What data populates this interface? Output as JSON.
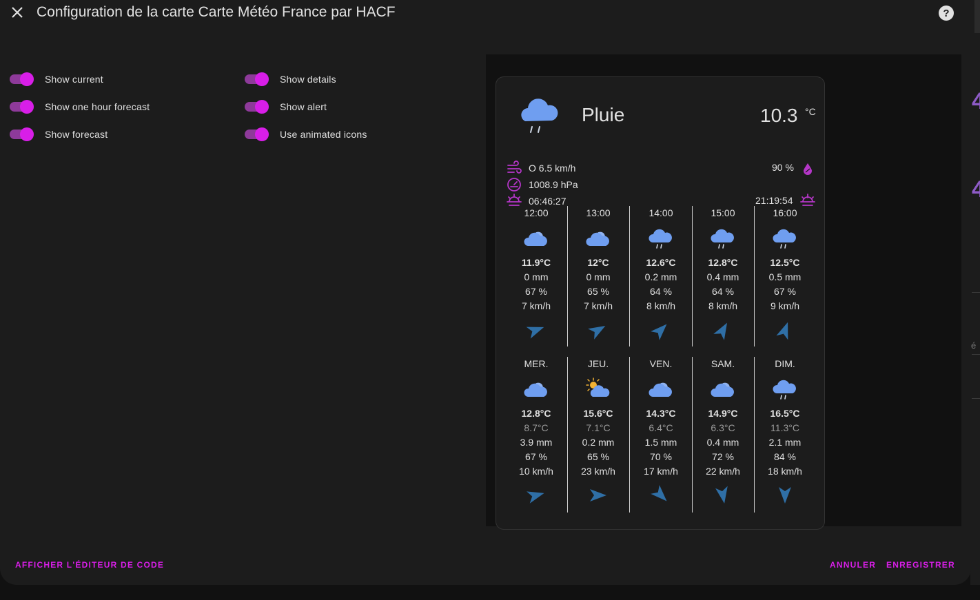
{
  "dialog": {
    "title": "Configuration de la carte Carte Météo France par HACF",
    "help_label": "?",
    "code_editor_label": "AFFICHER L'ÉDITEUR DE CODE",
    "cancel_label": "ANNULER",
    "save_label": "ENREGISTRER"
  },
  "toggles": [
    {
      "label": "Show current",
      "checked": true
    },
    {
      "label": "Show one hour forecast",
      "checked": true
    },
    {
      "label": "Show forecast",
      "checked": true
    },
    {
      "label": "Show details",
      "checked": true
    },
    {
      "label": "Show alert",
      "checked": true
    },
    {
      "label": "Use animated icons",
      "checked": true
    }
  ],
  "colors": {
    "accent": "#d81ee8",
    "icon_cloud": "#6f9ef0",
    "wind_arrow": "#2f6fa6"
  },
  "current": {
    "condition": "Pluie",
    "icon": "rainy-icon",
    "temperature": "10.3",
    "unit": "°C",
    "wind": "O 6.5 km/h",
    "humidity": "90 %",
    "pressure": "1008.9 hPa",
    "sunrise": "06:46:27",
    "sunset": "21:19:54"
  },
  "hourly": [
    {
      "time": "12:00",
      "icon": "cloudy-icon",
      "temp": "11.9°C",
      "precip": "0 mm",
      "humidity": "67 %",
      "wind": "7 km/h",
      "wind_deg": 70
    },
    {
      "time": "13:00",
      "icon": "cloudy-icon",
      "temp": "12°C",
      "precip": "0 mm",
      "humidity": "65 %",
      "wind": "7 km/h",
      "wind_deg": 60
    },
    {
      "time": "14:00",
      "icon": "rainy-icon",
      "temp": "12.6°C",
      "precip": "0.2 mm",
      "humidity": "64 %",
      "wind": "8 km/h",
      "wind_deg": 45
    },
    {
      "time": "15:00",
      "icon": "rainy-icon",
      "temp": "12.8°C",
      "precip": "0.4 mm",
      "humidity": "64 %",
      "wind": "8 km/h",
      "wind_deg": 30
    },
    {
      "time": "16:00",
      "icon": "rainy-icon",
      "temp": "12.5°C",
      "precip": "0.5 mm",
      "humidity": "67 %",
      "wind": "9 km/h",
      "wind_deg": 20
    }
  ],
  "daily": [
    {
      "day": "MER.",
      "icon": "cloudy-icon",
      "temp_high": "12.8°C",
      "temp_low": "8.7°C",
      "precip": "3.9 mm",
      "humidity": "67 %",
      "wind": "10 km/h",
      "wind_deg": 75
    },
    {
      "day": "JEU.",
      "icon": "partly-cloudy-icon",
      "temp_high": "15.6°C",
      "temp_low": "7.1°C",
      "precip": "0.2 mm",
      "humidity": "65 %",
      "wind": "23 km/h",
      "wind_deg": 90
    },
    {
      "day": "VEN.",
      "icon": "cloudy-icon",
      "temp_high": "14.3°C",
      "temp_low": "6.4°C",
      "precip": "1.5 mm",
      "humidity": "70 %",
      "wind": "17 km/h",
      "wind_deg": 135
    },
    {
      "day": "SAM.",
      "icon": "cloudy-icon",
      "temp_high": "14.9°C",
      "temp_low": "6.3°C",
      "precip": "0.4 mm",
      "humidity": "72 %",
      "wind": "22 km/h",
      "wind_deg": 170
    },
    {
      "day": "DIM.",
      "icon": "rainy-icon",
      "temp_high": "16.5°C",
      "temp_low": "11.3°C",
      "precip": "2.1 mm",
      "humidity": "84 %",
      "wind": "18 km/h",
      "wind_deg": 180
    }
  ]
}
